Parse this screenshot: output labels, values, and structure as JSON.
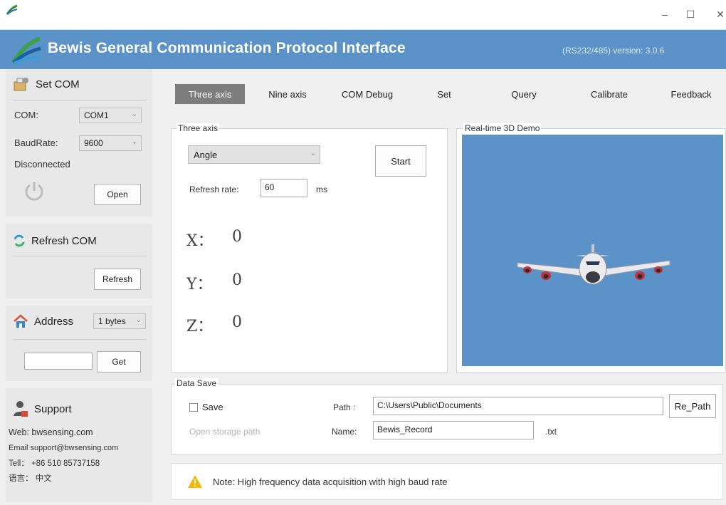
{
  "window": {
    "minimize": "–",
    "maximize": "☐",
    "close": "✕"
  },
  "banner": {
    "title": "Bewis General Communication Protocol Interface",
    "version": "(RS232/485)  version: 3.0.6"
  },
  "sidebar": {
    "set_com": {
      "title": "Set COM",
      "com_label": "COM:",
      "com_value": "COM1",
      "baud_label": "BaudRate:",
      "baud_value": "9600",
      "status": "Disconnected",
      "open_label": "Open"
    },
    "refresh_com": {
      "title": "Refresh COM",
      "refresh_label": "Refresh"
    },
    "address": {
      "title": "Address",
      "bytes_value": "1 bytes",
      "address_value": "",
      "get_label": "Get"
    },
    "support": {
      "title": "Support",
      "web": "Web: bwsensing.com",
      "email": "Email support@bwsensing.com",
      "tel": "Tell： +86 510 85737158",
      "lang": "语言： 中文"
    }
  },
  "tabs": [
    "Three axis",
    "Nine axis",
    "COM Debug",
    "Set",
    "Query",
    "Calibrate",
    "Feedback"
  ],
  "three_axis": {
    "group_title": "Three axis",
    "mode_value": "Angle",
    "start_label": "Start",
    "refresh_label": "Refresh rate:",
    "refresh_value": "60",
    "refresh_unit": "ms",
    "x_label": "X：",
    "x_value": "0",
    "y_label": "Y：",
    "y_value": "0",
    "z_label": "Z：",
    "z_value": "0"
  },
  "demo": {
    "title": "Real-time 3D Demo"
  },
  "data_save": {
    "title": "Data Save",
    "save_label": "Save",
    "save_checked": false,
    "open_path_label": "Open storage path",
    "path_label": "Path :",
    "path_value": "C:\\Users\\Public\\Documents",
    "repath_label": "Re_Path",
    "name_label": "Name:",
    "name_value": "Bewis_Record",
    "ext": ".txt"
  },
  "note": {
    "text": "Note: High frequency data acquisition with high baud rate"
  },
  "colors": {
    "accent": "#5b93c9",
    "active_tab": "#7d7d7d",
    "warning": "#f2b705"
  }
}
